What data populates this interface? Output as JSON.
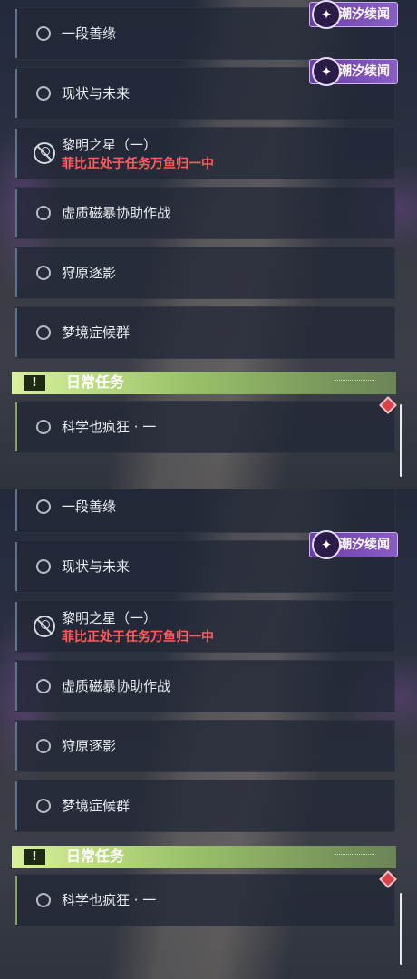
{
  "tracker": {
    "badge_label": "潮汐续闻",
    "badge_icon": "tidal-news-logo-icon",
    "quests": [
      {
        "label": "一段善缘"
      },
      {
        "label": "现状与未来"
      },
      {
        "label": "黎明之星（一）",
        "warning": "菲比正处于任务万鱼归一中"
      },
      {
        "label": "虚质磁暴协助作战"
      },
      {
        "label": "狩原逐影"
      },
      {
        "label": "梦境症候群"
      }
    ],
    "daily_section": {
      "title": "日常任务",
      "icon": "!",
      "quests": [
        {
          "label": "科学也疯狂 · 一"
        }
      ]
    },
    "colors": {
      "warning_text": "#ff5b5b",
      "daily_accent": "#9bc36a",
      "badge_purple": "#7a4db8",
      "marker_red": "#d8404c"
    }
  }
}
